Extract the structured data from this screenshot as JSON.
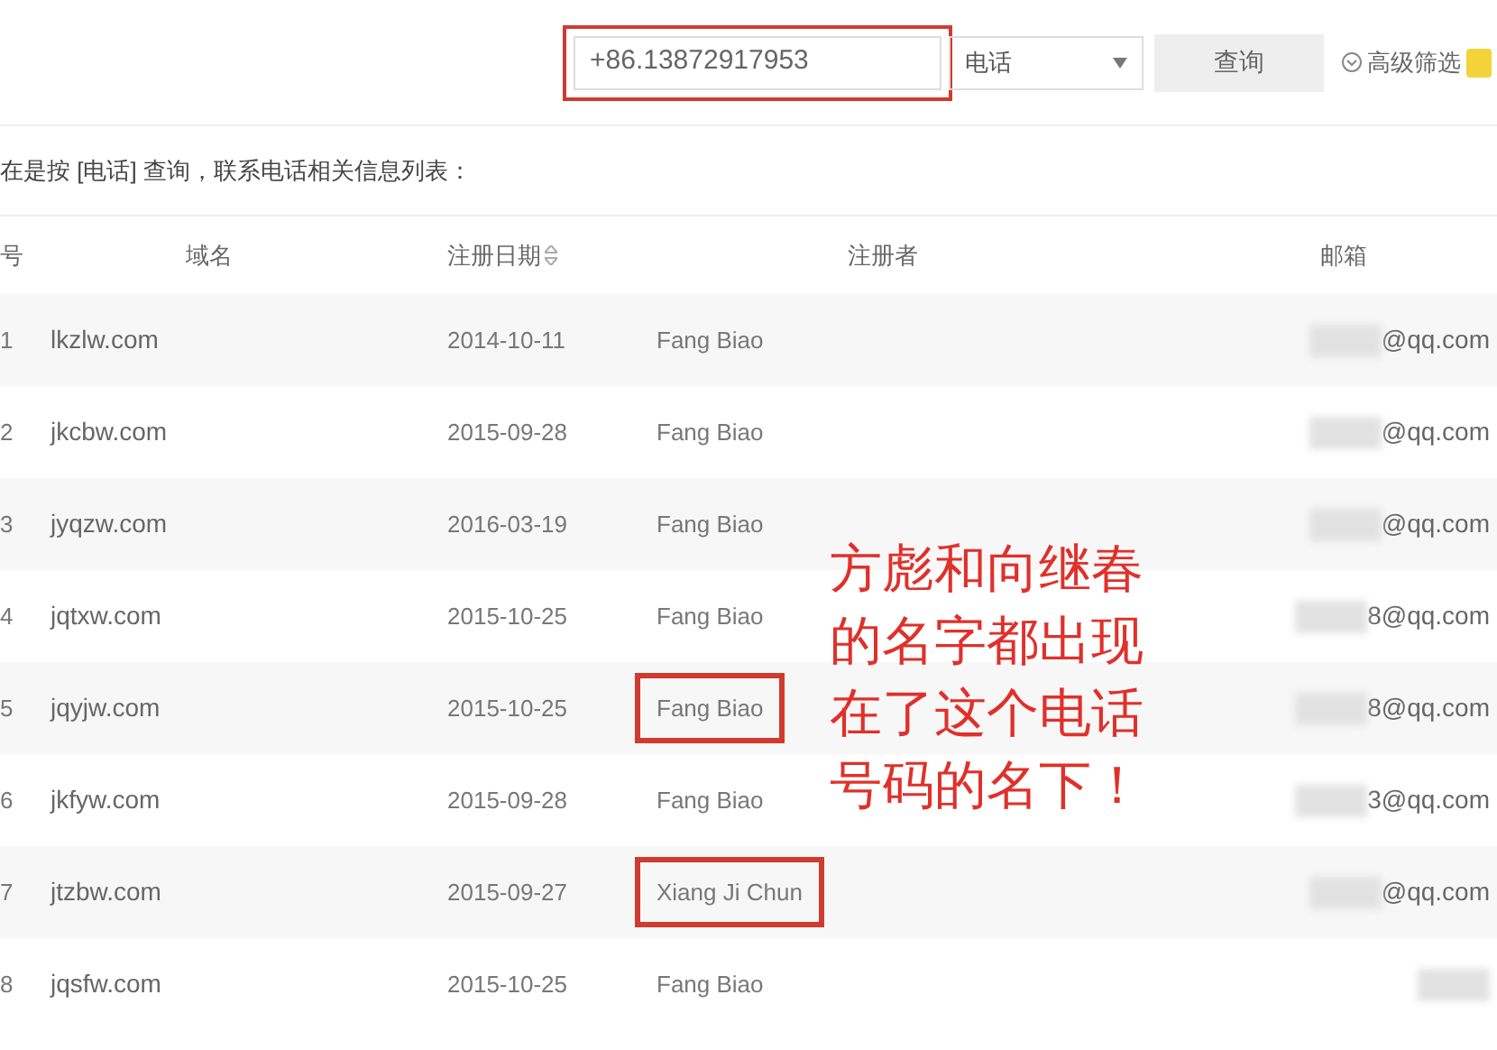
{
  "search": {
    "value": "+86.13872917953",
    "highlighted": true,
    "type_select": "电话",
    "button": "查询",
    "advanced": "高级筛选"
  },
  "info_text": "在是按 [电话] 查询，联系电话相关信息列表：",
  "table": {
    "columns": [
      "号",
      "域名",
      "注册日期",
      "注册者",
      "邮箱"
    ],
    "rows": [
      {
        "number": "1",
        "domain": "lkzlw.com",
        "date": "2014-10-11",
        "registrant": "Fang Biao",
        "registrant_highlighted": false,
        "email": "@qq.com"
      },
      {
        "number": "2",
        "domain": "jkcbw.com",
        "date": "2015-09-28",
        "registrant": "Fang Biao",
        "registrant_highlighted": false,
        "email": "@qq.com"
      },
      {
        "number": "3",
        "domain": "jyqzw.com",
        "date": "2016-03-19",
        "registrant": "Fang Biao",
        "registrant_highlighted": false,
        "email": "@qq.com"
      },
      {
        "number": "4",
        "domain": "jqtxw.com",
        "date": "2015-10-25",
        "registrant": "Fang Biao",
        "registrant_highlighted": false,
        "email": "8@qq.com"
      },
      {
        "number": "5",
        "domain": "jqyjw.com",
        "date": "2015-10-25",
        "registrant": "Fang Biao",
        "registrant_highlighted": true,
        "email": "8@qq.com"
      },
      {
        "number": "6",
        "domain": "jkfyw.com",
        "date": "2015-09-28",
        "registrant": "Fang Biao",
        "registrant_highlighted": false,
        "email": "3@qq.com"
      },
      {
        "number": "7",
        "domain": "jtzbw.com",
        "date": "2015-09-27",
        "registrant": "Xiang Ji Chun",
        "registrant_highlighted": true,
        "email": "@qq.com"
      },
      {
        "number": "8",
        "domain": "jqsfw.com",
        "date": "2015-10-25",
        "registrant": "Fang Biao",
        "registrant_highlighted": false
      }
    ]
  },
  "annotation": {
    "lines": [
      "方彪和向继春",
      "的名字都出现",
      "在了这个电话",
      "号码的名下！"
    ]
  }
}
